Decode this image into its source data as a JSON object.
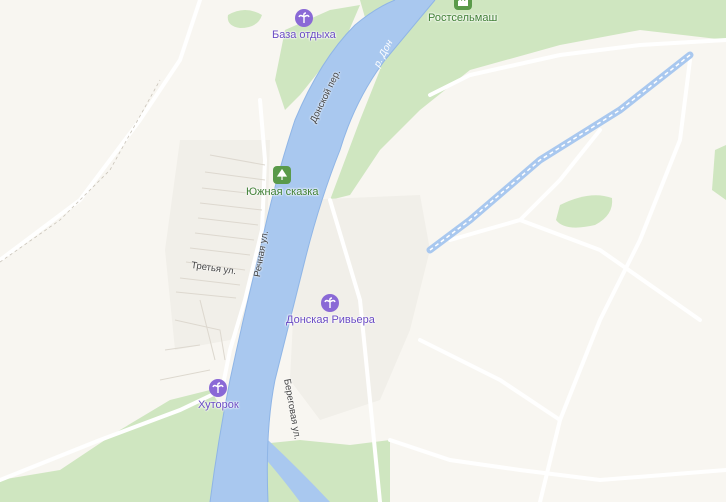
{
  "map": {
    "pois": [
      {
        "id": "baza-otdyha",
        "label": "База отдыха",
        "kind": "purple",
        "icon": "palm-icon"
      },
      {
        "id": "rostselmash",
        "label": "Ростсельмаш",
        "kind": "green",
        "icon": "factory-icon"
      },
      {
        "id": "yuzhnaya-skazka",
        "label": "Южная сказка",
        "kind": "green",
        "icon": "park-icon"
      },
      {
        "id": "donskaya-riviera",
        "label": "Донская Ривьера",
        "kind": "purple",
        "icon": "palm-icon"
      },
      {
        "id": "hutorok",
        "label": "Хуторок",
        "kind": "purple",
        "icon": "palm-icon"
      }
    ],
    "streets": {
      "donskoy": "Донской пер.",
      "rechnaya": "Речная ул.",
      "tretya": "Третья ул.",
      "beregovaya": "Береговая ул."
    },
    "river": "р. Дон",
    "colors": {
      "water": "#a9c8ef",
      "park": "#cfe6c0",
      "land": "#f8f6f1",
      "road": "#ffffff",
      "accent_purple": "#8a69d6",
      "accent_green": "#5a9a4a"
    }
  }
}
